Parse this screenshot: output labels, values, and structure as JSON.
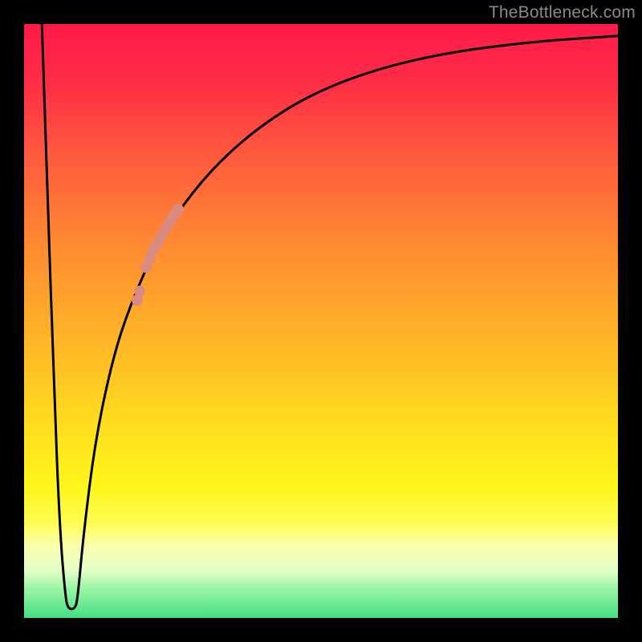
{
  "watermark": "TheBottleneck.com",
  "chart_data": {
    "type": "line",
    "title": "",
    "xlabel": "",
    "ylabel": "",
    "xlim": [
      0,
      100
    ],
    "ylim": [
      0,
      100
    ],
    "grid": false,
    "legend": false,
    "curve": [
      {
        "x": 3.0,
        "y": 100.0
      },
      {
        "x": 4.0,
        "y": 70.0
      },
      {
        "x": 5.0,
        "y": 40.0
      },
      {
        "x": 6.0,
        "y": 15.0
      },
      {
        "x": 7.0,
        "y": 3.0
      },
      {
        "x": 7.5,
        "y": 1.5
      },
      {
        "x": 8.5,
        "y": 1.5
      },
      {
        "x": 9.0,
        "y": 3.0
      },
      {
        "x": 10.0,
        "y": 14.0
      },
      {
        "x": 12.0,
        "y": 30.0
      },
      {
        "x": 15.0,
        "y": 44.0
      },
      {
        "x": 18.0,
        "y": 53.0
      },
      {
        "x": 22.0,
        "y": 62.0
      },
      {
        "x": 27.0,
        "y": 70.0
      },
      {
        "x": 33.0,
        "y": 77.0
      },
      {
        "x": 40.0,
        "y": 83.0
      },
      {
        "x": 48.0,
        "y": 88.0
      },
      {
        "x": 58.0,
        "y": 92.0
      },
      {
        "x": 70.0,
        "y": 95.0
      },
      {
        "x": 85.0,
        "y": 97.0
      },
      {
        "x": 100.0,
        "y": 98.0
      }
    ],
    "markers": [
      {
        "x": 20.5,
        "y": 59.0
      },
      {
        "x": 21.2,
        "y": 60.5
      },
      {
        "x": 21.8,
        "y": 62.0
      },
      {
        "x": 22.5,
        "y": 63.3
      },
      {
        "x": 23.2,
        "y": 64.5
      },
      {
        "x": 23.9,
        "y": 65.7
      },
      {
        "x": 24.6,
        "y": 66.8
      },
      {
        "x": 25.3,
        "y": 67.8
      },
      {
        "x": 26.0,
        "y": 68.8
      },
      {
        "x": 19.5,
        "y": 55.0
      },
      {
        "x": 19.0,
        "y": 53.5
      }
    ],
    "marker_color": "#d98a81",
    "gradient_stops": [
      {
        "pos": 0,
        "color": "#ff1a49"
      },
      {
        "pos": 50,
        "color": "#ffc020"
      },
      {
        "pos": 80,
        "color": "#fff61a"
      },
      {
        "pos": 100,
        "color": "#43e083"
      }
    ]
  }
}
